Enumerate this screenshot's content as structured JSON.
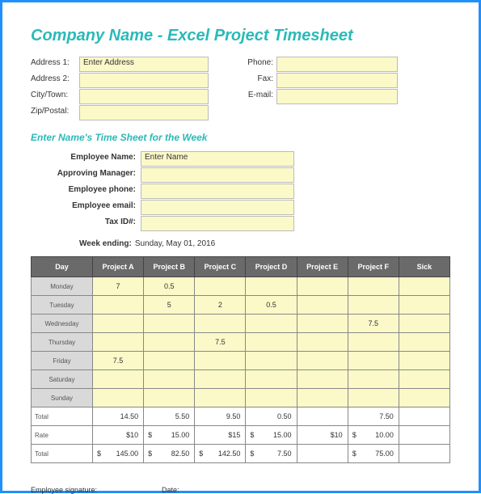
{
  "title": "Company Name - Excel Project Timesheet",
  "address": {
    "labels": {
      "addr1": "Address 1:",
      "addr2": "Address 2:",
      "city": "City/Town:",
      "zip": "Zip/Postal:",
      "phone": "Phone:",
      "fax": "Fax:",
      "email": "E-mail:"
    },
    "values": {
      "addr1": "Enter Address",
      "addr2": "",
      "city": "",
      "zip": "",
      "phone": "",
      "fax": "",
      "email": ""
    }
  },
  "subtitle": "Enter Name's Time Sheet for the Week",
  "employee": {
    "labels": {
      "name": "Employee Name:",
      "mgr": "Approving Manager:",
      "phone": "Employee phone:",
      "email": "Employee email:",
      "tax": "Tax ID#:"
    },
    "values": {
      "name": "Enter Name",
      "mgr": "",
      "phone": "",
      "email": "",
      "tax": ""
    }
  },
  "weekending": {
    "label": "Week ending:",
    "value": "Sunday, May 01, 2016"
  },
  "headers": [
    "Day",
    "Project A",
    "Project B",
    "Project C",
    "Project D",
    "Project E",
    "Project F",
    "Sick"
  ],
  "rows": [
    {
      "day": "Monday",
      "vals": [
        "7",
        "0.5",
        "",
        "",
        "",
        "",
        ""
      ]
    },
    {
      "day": "Tuesday",
      "vals": [
        "",
        "5",
        "2",
        "0.5",
        "",
        "",
        ""
      ]
    },
    {
      "day": "Wednesday",
      "vals": [
        "",
        "",
        "",
        "",
        "",
        "7.5",
        ""
      ]
    },
    {
      "day": "Thursday",
      "vals": [
        "",
        "",
        "7.5",
        "",
        "",
        "",
        ""
      ]
    },
    {
      "day": "Friday",
      "vals": [
        "7.5",
        "",
        "",
        "",
        "",
        "",
        ""
      ]
    },
    {
      "day": "Saturday",
      "vals": [
        "",
        "",
        "",
        "",
        "",
        "",
        ""
      ]
    },
    {
      "day": "Sunday",
      "vals": [
        "",
        "",
        "",
        "",
        "",
        "",
        ""
      ]
    }
  ],
  "totals": {
    "label": "Total",
    "vals": [
      "14.50",
      "5.50",
      "9.50",
      "0.50",
      "",
      "7.50",
      ""
    ]
  },
  "rate": {
    "label": "Rate",
    "vals": [
      "$10",
      "15.00",
      "$15",
      "15.00",
      "$10",
      "10.00",
      ""
    ]
  },
  "grand": {
    "label": "Total",
    "vals": [
      "145.00",
      "82.50",
      "142.50",
      "7.50",
      "",
      "75.00",
      ""
    ]
  },
  "sig": {
    "emp": "Employee signature:",
    "date": "Date:"
  }
}
